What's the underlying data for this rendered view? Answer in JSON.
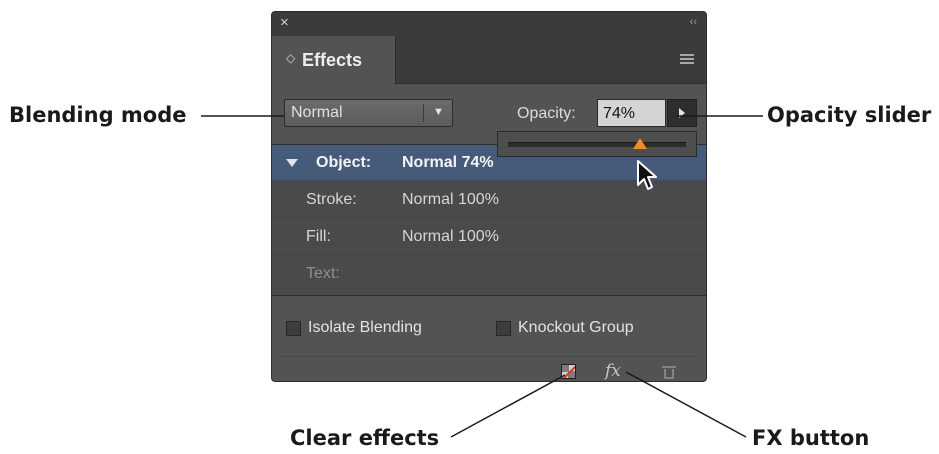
{
  "callouts": {
    "blending_mode": "Blending mode",
    "opacity_slider": "Opacity slider",
    "clear_effects": "Clear effects",
    "fx_button": "FX button"
  },
  "panel": {
    "close_glyph": "×",
    "collapse_glyph": "‹‹",
    "tab_arrows_glyph": "◇",
    "tab_title": "Effects",
    "menu_icon": "panel-menu-icon",
    "blending_mode": {
      "value": "Normal"
    },
    "opacity": {
      "label": "Opacity:",
      "value": "74%",
      "slider_fraction": 0.74
    },
    "effects_rows": [
      {
        "label": "Object:",
        "value": "Normal 74%",
        "selected": true
      },
      {
        "label": "Stroke:",
        "value": "Normal 100%",
        "selected": false
      },
      {
        "label": "Fill:",
        "value": "Normal 100%",
        "selected": false
      },
      {
        "label": "Text:",
        "value": "",
        "selected": false
      }
    ],
    "checkboxes": [
      {
        "label": "Isolate Blending",
        "checked": false
      },
      {
        "label": "Knockout Group",
        "checked": false
      }
    ],
    "footer_icons": [
      "clear-effects-icon",
      "fx-icon",
      "trash-icon"
    ],
    "fx_glyph": "fx"
  },
  "colors": {
    "panel_bg": "#535353",
    "selected_row": "#465a7a",
    "slider_thumb": "#f08c22"
  }
}
